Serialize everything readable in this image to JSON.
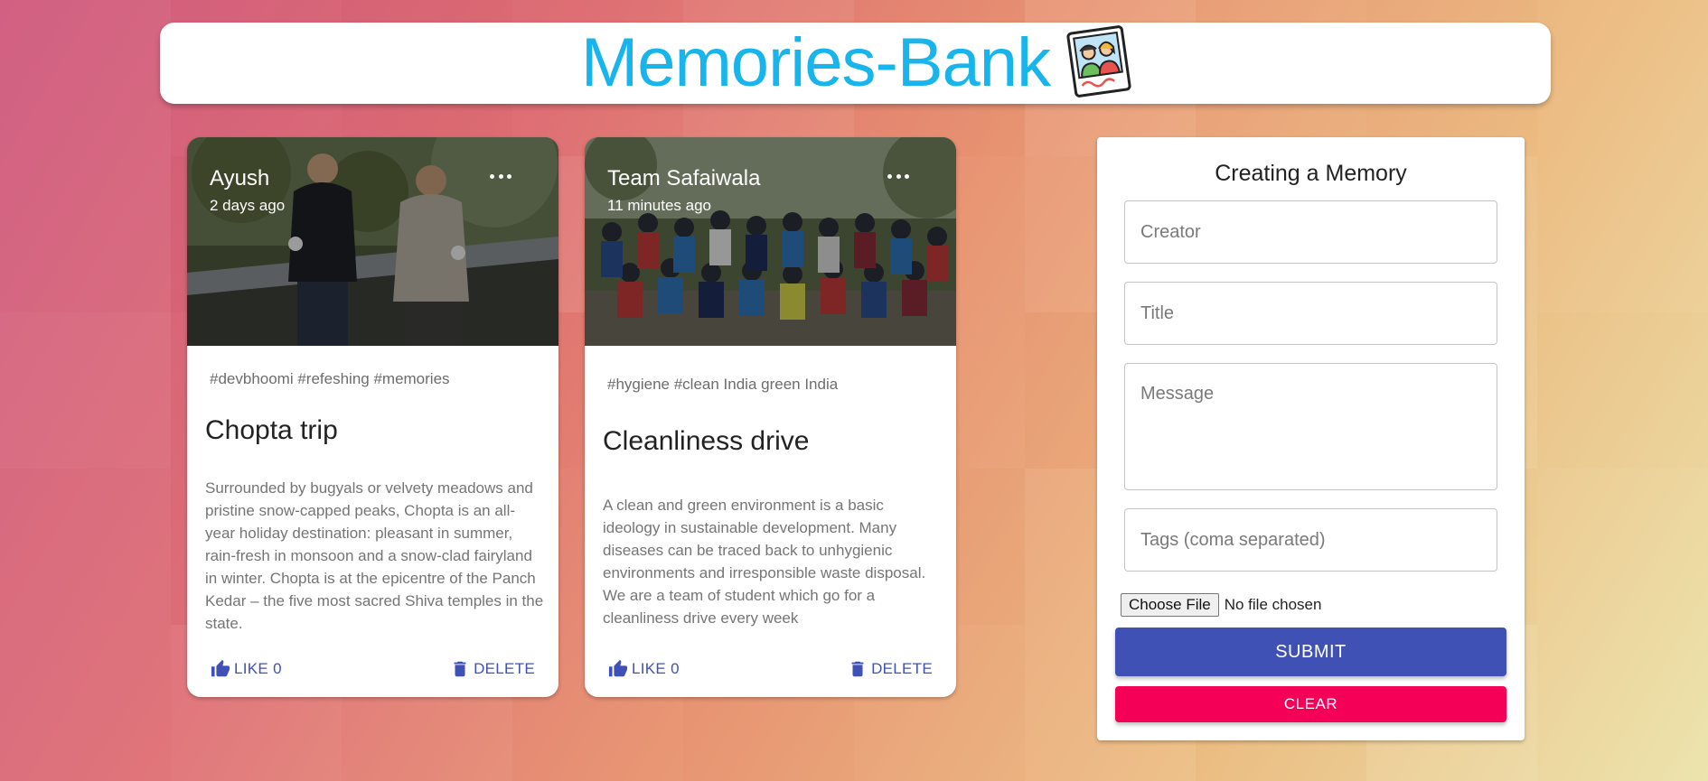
{
  "app": {
    "title": "Memories-Bank",
    "logo_icon": "photo-memories-icon"
  },
  "posts": [
    {
      "creator": "Ayush",
      "time": "2 days ago",
      "tags": "#devbhoomi #refeshing #memories",
      "title": "Chopta trip",
      "message": "Surrounded by bugyals or velvety meadows and pristine snow-capped peaks, Chopta is an all-year holiday destination: pleasant in summer, rain-fresh in monsoon and a snow-clad fairyland in winter. Chopta is at the epicentre of the Panch Kedar – the five most sacred Shiva temples in the state.",
      "like_label": "LIKE 0",
      "delete_label": "DELETE"
    },
    {
      "creator": "Team Safaiwala",
      "time": "11 minutes ago",
      "tags": "#hygiene #clean India green India",
      "title": "Cleanliness drive",
      "message": "A clean and green environment is a basic ideology in sustainable development. Many diseases can be traced back to unhygienic environments and irresponsible waste disposal. We are a team of student which go for a cleanliness drive every week",
      "like_label": "LIKE 0",
      "delete_label": "DELETE"
    }
  ],
  "form": {
    "heading": "Creating a Memory",
    "creator_placeholder": "Creator",
    "title_placeholder": "Title",
    "message_placeholder": "Message",
    "tags_placeholder": "Tags (coma separated)",
    "file_button": "Choose File",
    "file_status": "No file chosen",
    "submit_label": "SUBMIT",
    "clear_label": "CLEAR"
  },
  "colors": {
    "accent": "#3f51b5",
    "secondary": "#f50057",
    "title": "#18b4ec"
  }
}
